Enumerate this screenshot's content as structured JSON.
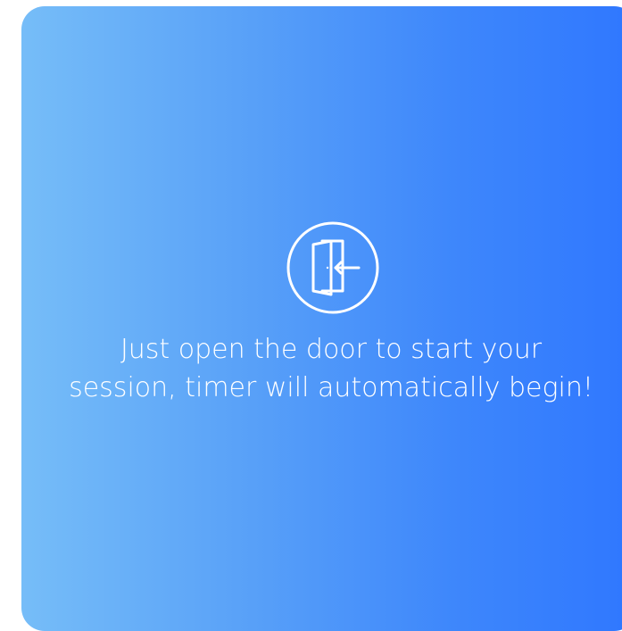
{
  "card": {
    "gradient_start": "#76bdf8",
    "gradient_end": "#2f77ff",
    "icon": "door-enter-icon",
    "message_line1": "Just open the door to start your",
    "message_line2": "session, timer will automatically begin!"
  }
}
